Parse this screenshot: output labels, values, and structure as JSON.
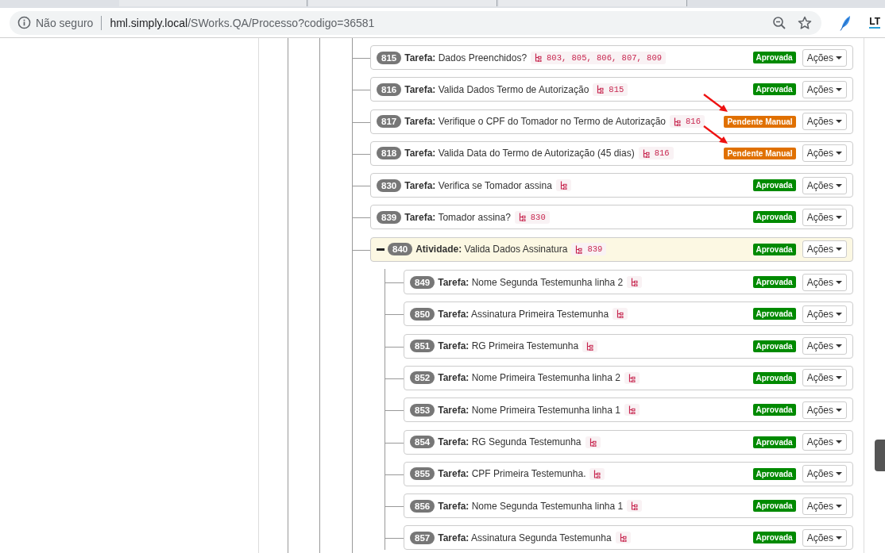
{
  "browser": {
    "security": "Não seguro",
    "url_host": "hml.simply.local",
    "url_path": "/SWorks.QA/Processo?codigo=36581",
    "extension_label": "LT"
  },
  "items": [
    {
      "id": "815",
      "kind": "task",
      "type_label": "Tarefa:",
      "title": "Dados Preenchidos?",
      "deps": "803, 805, 806, 807, 809",
      "status": "Aprovada",
      "approved": true,
      "annotated": false,
      "actions": "Ações"
    },
    {
      "id": "816",
      "kind": "task",
      "type_label": "Tarefa:",
      "title": "Valida Dados Termo de Autorização",
      "deps": "815",
      "status": "Aprovada",
      "approved": true,
      "annotated": false,
      "actions": "Ações"
    },
    {
      "id": "817",
      "kind": "task",
      "type_label": "Tarefa:",
      "title": "Verifique o CPF do Tomador no Termo de Autorização",
      "deps": "816",
      "status": "Pendente Manual",
      "approved": false,
      "annotated": true,
      "actions": "Ações"
    },
    {
      "id": "818",
      "kind": "task",
      "type_label": "Tarefa:",
      "title": "Valida Data do Termo de Autorização (45 dias)",
      "deps": "816",
      "status": "Pendente Manual",
      "approved": false,
      "annotated": true,
      "actions": "Ações"
    },
    {
      "id": "830",
      "kind": "task",
      "type_label": "Tarefa:",
      "title": "Verifica se Tomador assina",
      "status": "Aprovada",
      "approved": true,
      "annotated": false,
      "actions": "Ações"
    },
    {
      "id": "839",
      "kind": "task",
      "type_label": "Tarefa:",
      "title": "Tomador assina?",
      "deps": "830",
      "status": "Aprovada",
      "approved": true,
      "annotated": false,
      "actions": "Ações"
    },
    {
      "id": "840",
      "kind": "activity",
      "expanded": true,
      "type_label": "Atividade:",
      "title": "Valida Dados Assinatura",
      "deps": "839",
      "status": "Aprovada",
      "approved": true,
      "annotated": false,
      "actions": "Ações",
      "children": [
        {
          "id": "849",
          "kind": "task",
          "type_label": "Tarefa:",
          "title": "Nome Segunda Testemunha linha 2",
          "status": "Aprovada",
          "approved": true,
          "annotated": false,
          "actions": "Ações"
        },
        {
          "id": "850",
          "kind": "task",
          "type_label": "Tarefa:",
          "title": "Assinatura Primeira Testemunha",
          "status": "Aprovada",
          "approved": true,
          "annotated": false,
          "actions": "Ações"
        },
        {
          "id": "851",
          "kind": "task",
          "type_label": "Tarefa:",
          "title": "RG Primeira Testemunha",
          "status": "Aprovada",
          "approved": true,
          "annotated": false,
          "actions": "Ações"
        },
        {
          "id": "852",
          "kind": "task",
          "type_label": "Tarefa:",
          "title": "Nome Primeira Testemunha linha 2",
          "status": "Aprovada",
          "approved": true,
          "annotated": false,
          "actions": "Ações"
        },
        {
          "id": "853",
          "kind": "task",
          "type_label": "Tarefa:",
          "title": "Nome Primeira Testemunha linha 1",
          "status": "Aprovada",
          "approved": true,
          "annotated": false,
          "actions": "Ações"
        },
        {
          "id": "854",
          "kind": "task",
          "type_label": "Tarefa:",
          "title": "RG Segunda Testemunha",
          "status": "Aprovada",
          "approved": true,
          "annotated": false,
          "actions": "Ações"
        },
        {
          "id": "855",
          "kind": "task",
          "type_label": "Tarefa:",
          "title": "CPF Primeira Testemunha.",
          "status": "Aprovada",
          "approved": true,
          "annotated": false,
          "actions": "Ações"
        },
        {
          "id": "856",
          "kind": "task",
          "type_label": "Tarefa:",
          "title": "Nome Segunda Testemunha linha 1",
          "status": "Aprovada",
          "approved": true,
          "annotated": false,
          "actions": "Ações"
        },
        {
          "id": "857",
          "kind": "task",
          "type_label": "Tarefa:",
          "title": "Assinatura Segunda Testemunha",
          "status": "Aprovada",
          "approved": true,
          "annotated": false,
          "actions": "Ações"
        }
      ]
    }
  ]
}
